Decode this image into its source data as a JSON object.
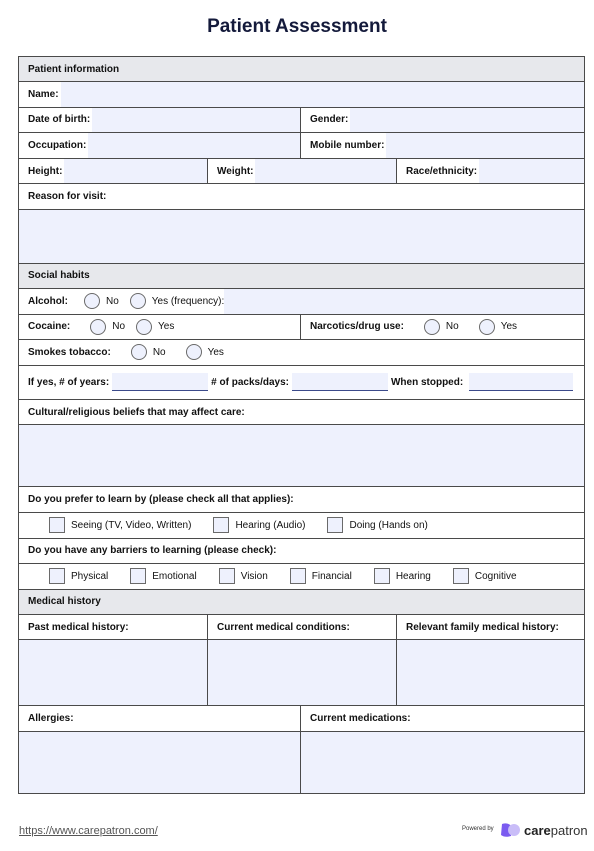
{
  "title": "Patient Assessment",
  "patient_info": {
    "header": "Patient information",
    "name": "Name:",
    "dob": "Date of birth:",
    "gender": "Gender:",
    "occupation": "Occupation:",
    "mobile": "Mobile number:",
    "height": "Height:",
    "weight": "Weight:",
    "race": "Race/ethnicity:",
    "reason": "Reason for visit:"
  },
  "social": {
    "header": "Social habits",
    "alcohol": "Alcohol:",
    "alcohol_no": "No",
    "alcohol_yes": "Yes (frequency):",
    "cocaine": "Cocaine:",
    "cocaine_no": "No",
    "cocaine_yes": "Yes",
    "narcotics": "Narcotics/drug use:",
    "narcotics_no": "No",
    "narcotics_yes": "Yes",
    "tobacco": "Smokes tobacco:",
    "tobacco_no": "No",
    "tobacco_yes": "Yes",
    "years": "If yes, # of years:",
    "packs": "# of packs/days:",
    "stopped": "When stopped:",
    "cultural": "Cultural/religious beliefs that may affect care:",
    "learn_q": "Do you prefer to learn by (please check all that applies):",
    "learn_opts": [
      "Seeing (TV, Video, Written)",
      "Hearing (Audio)",
      "Doing (Hands on)"
    ],
    "barriers_q": "Do you have any barriers to learning (please check):",
    "barrier_opts": [
      "Physical",
      "Emotional",
      "Vision",
      "Financial",
      "Hearing",
      "Cognitive"
    ]
  },
  "medical": {
    "header": "Medical history",
    "past": "Past medical history:",
    "current": "Current medical conditions:",
    "family": "Relevant family medical history:",
    "allergies": "Allergies:",
    "medications": "Current medications:"
  },
  "footer": {
    "url": "https://www.carepatron.com/",
    "powered_by": "Powered by",
    "brand_bold": "care",
    "brand_rest": "patron"
  }
}
